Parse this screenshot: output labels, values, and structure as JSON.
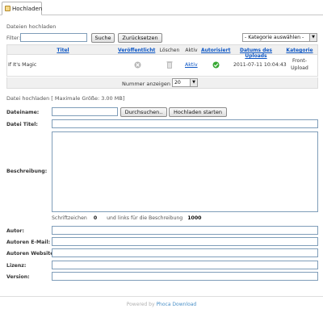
{
  "tab": {
    "label": "Hochladen"
  },
  "files_section": {
    "title": "Dateien hochladen"
  },
  "filter": {
    "label": "Filter:",
    "value": "",
    "search_button": "Suche",
    "reset_button": "Zurücksetzen",
    "category_select": "- Kategorie auswählen -"
  },
  "table": {
    "headers": {
      "title": "Titel",
      "published": "Veröffentlicht",
      "delete": "Löschen",
      "active": "Aktiv",
      "authorized": "Autorisiert",
      "upload_date": "Datums des Uploads",
      "category": "Kategorie"
    },
    "rows": [
      {
        "title": "If It's Magic",
        "active": "Aktiv",
        "date": "2011-07-11 10:04:43",
        "category_line1": "Front-",
        "category_line2": "Upload"
      }
    ]
  },
  "pager": {
    "label": "Nummer anzeigen",
    "value": "20"
  },
  "upload": {
    "title": "Datei hochladen [ Maximale Größe: 3.00 MB]",
    "filename_label": "Dateiname:",
    "browse_button": "Durchsuchen..",
    "start_button": "Hochladen starten",
    "file_title_label": "Datei Titel:",
    "description_label": "Beschreibung:",
    "char_count_prefix": "Schriftzeichen",
    "char_count": "0",
    "char_left_text": "und links für die Beschreibung",
    "char_left": "1000",
    "author_label": "Autor:",
    "author_email_label": "Autoren E-Mail:",
    "author_website_label": "Autoren Website:",
    "license_label": "Lizenz:",
    "version_label": "Version:"
  },
  "footer": {
    "powered_by": "Powered by",
    "brand": "Phoca Download"
  },
  "colors": {
    "link": "#0b55c4",
    "published_icon": "#b5b5b5",
    "authorized_icon": "#36a832"
  }
}
